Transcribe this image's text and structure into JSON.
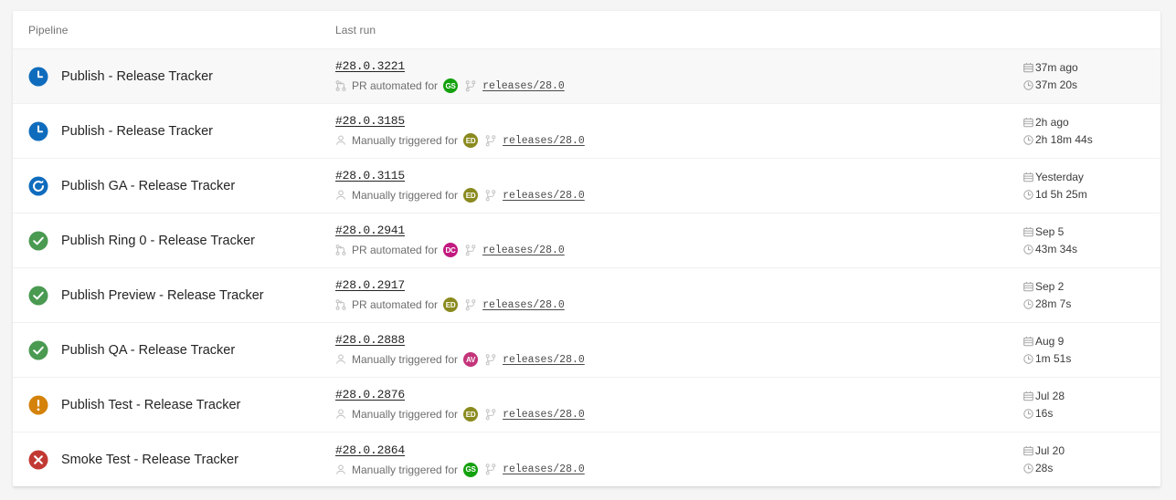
{
  "table": {
    "columns": {
      "pipeline": "Pipeline",
      "last_run": "Last run"
    }
  },
  "colors": {
    "status_queued": "#0f6cbd",
    "status_running": "#0f6cbd",
    "status_succeeded": "#4a9a52",
    "status_warning": "#d4820a",
    "status_failed": "#c23934",
    "avatar_green": "#13a10e",
    "avatar_olive": "#8a8a1f",
    "avatar_magenta": "#c2197f",
    "avatar_pink": "#c3347a",
    "row_hover": "#f8f8f8",
    "page_background": "#f5f5f5",
    "card_background": "#ffffff",
    "border": "#f0f0f0"
  },
  "rows": [
    {
      "status": "queued",
      "status_icon": "clock-icon",
      "pipeline": "Publish - Release Tracker",
      "run_id": "#28.0.3221",
      "trigger_icon": "pull-request-icon",
      "trigger_text": "PR automated for",
      "avatar_initials": "GS",
      "avatar_color": "#13a10e",
      "branch_icon": "branch-icon",
      "branch": "releases/28.0",
      "when": "37m ago",
      "duration": "37m 20s",
      "hovered": true
    },
    {
      "status": "queued",
      "status_icon": "clock-icon",
      "pipeline": "Publish - Release Tracker",
      "run_id": "#28.0.3185",
      "trigger_icon": "person-icon",
      "trigger_text": "Manually triggered for",
      "avatar_initials": "ED",
      "avatar_color": "#8a8a1f",
      "branch_icon": "branch-icon",
      "branch": "releases/28.0",
      "when": "2h ago",
      "duration": "2h 18m 44s",
      "hovered": false
    },
    {
      "status": "running",
      "status_icon": "spinner-icon",
      "pipeline": "Publish GA - Release Tracker",
      "run_id": "#28.0.3115",
      "trigger_icon": "person-icon",
      "trigger_text": "Manually triggered for",
      "avatar_initials": "ED",
      "avatar_color": "#8a8a1f",
      "branch_icon": "branch-icon",
      "branch": "releases/28.0",
      "when": "Yesterday",
      "duration": "1d 5h 25m",
      "hovered": false
    },
    {
      "status": "succeeded",
      "status_icon": "check-circle-icon",
      "pipeline": "Publish Ring 0 - Release Tracker",
      "run_id": "#28.0.2941",
      "trigger_icon": "pull-request-icon",
      "trigger_text": "PR automated for",
      "avatar_initials": "DC",
      "avatar_color": "#c2197f",
      "branch_icon": "branch-icon",
      "branch": "releases/28.0",
      "when": "Sep 5",
      "duration": "43m 34s",
      "hovered": false
    },
    {
      "status": "succeeded",
      "status_icon": "check-circle-icon",
      "pipeline": "Publish Preview - Release Tracker",
      "run_id": "#28.0.2917",
      "trigger_icon": "pull-request-icon",
      "trigger_text": "PR automated for",
      "avatar_initials": "ED",
      "avatar_color": "#8a8a1f",
      "branch_icon": "branch-icon",
      "branch": "releases/28.0",
      "when": "Sep 2",
      "duration": "28m 7s",
      "hovered": false
    },
    {
      "status": "succeeded",
      "status_icon": "check-circle-icon",
      "pipeline": "Publish QA - Release Tracker",
      "run_id": "#28.0.2888",
      "trigger_icon": "person-icon",
      "trigger_text": "Manually triggered for",
      "avatar_initials": "AV",
      "avatar_color": "#c3347a",
      "branch_icon": "branch-icon",
      "branch": "releases/28.0",
      "when": "Aug 9",
      "duration": "1m 51s",
      "hovered": false
    },
    {
      "status": "warning",
      "status_icon": "exclamation-circle-icon",
      "pipeline": "Publish Test - Release Tracker",
      "run_id": "#28.0.2876",
      "trigger_icon": "person-icon",
      "trigger_text": "Manually triggered for",
      "avatar_initials": "ED",
      "avatar_color": "#8a8a1f",
      "branch_icon": "branch-icon",
      "branch": "releases/28.0",
      "when": "Jul 28",
      "duration": "16s",
      "hovered": false
    },
    {
      "status": "failed",
      "status_icon": "x-circle-icon",
      "pipeline": "Smoke Test - Release Tracker",
      "run_id": "#28.0.2864",
      "trigger_icon": "person-icon",
      "trigger_text": "Manually triggered for",
      "avatar_initials": "GS",
      "avatar_color": "#13a10e",
      "branch_icon": "branch-icon",
      "branch": "releases/28.0",
      "when": "Jul 20",
      "duration": "28s",
      "hovered": false
    }
  ]
}
